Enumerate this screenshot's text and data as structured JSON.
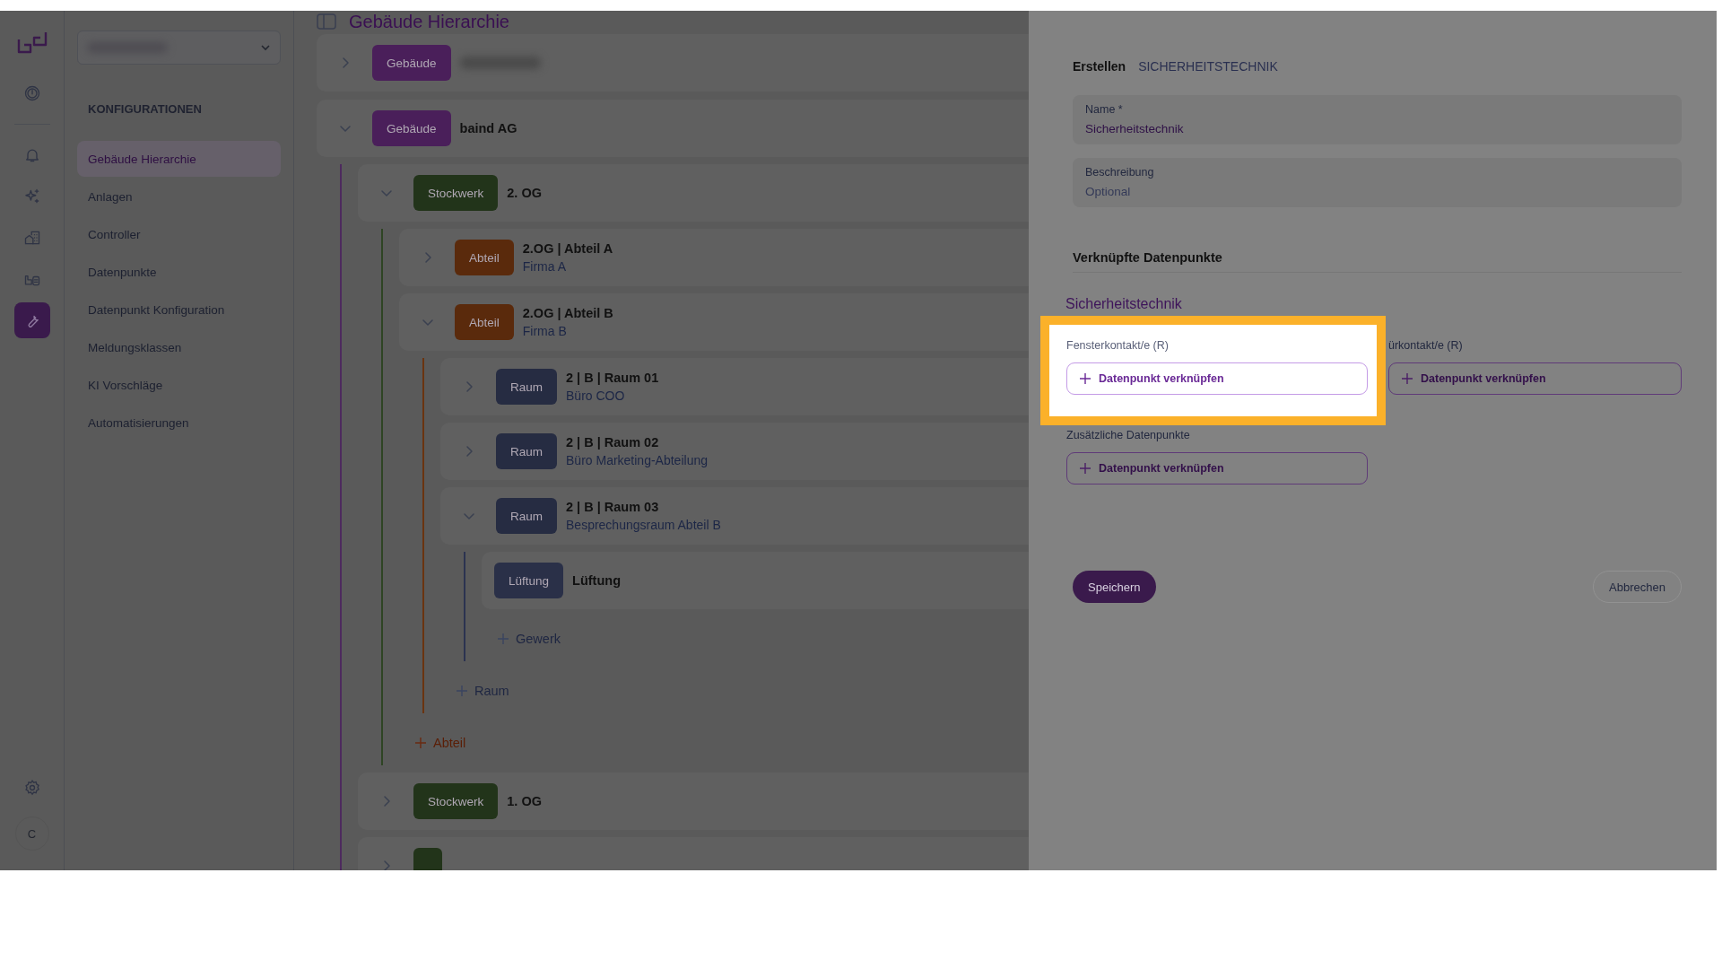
{
  "rail": {
    "items": [
      {
        "kind": "dashboard",
        "selected": false
      },
      {
        "kind": "bell",
        "selected": false
      },
      {
        "kind": "sparkles",
        "selected": false
      },
      {
        "kind": "buildings",
        "selected": false
      },
      {
        "kind": "plant",
        "selected": false
      },
      {
        "kind": "wrench",
        "selected": true
      }
    ],
    "avatar": "C"
  },
  "nav": {
    "heading": "KONFIGURATIONEN",
    "items": [
      {
        "label": "Gebäude Hierarchie",
        "selected": true
      },
      {
        "label": "Anlagen",
        "selected": false
      },
      {
        "label": "Controller",
        "selected": false
      },
      {
        "label": "Datenpunkte",
        "selected": false
      },
      {
        "label": "Datenpunkt Konfiguration",
        "selected": false
      },
      {
        "label": "Meldungsklassen",
        "selected": false
      },
      {
        "label": "KI Vorschläge",
        "selected": false
      },
      {
        "label": "Automatisierungen",
        "selected": false
      }
    ]
  },
  "main": {
    "title": "Gebäude Hierarchie",
    "tree": [
      {
        "kind": "building",
        "badge": "Gebäude",
        "redacted": true,
        "expanded": false
      },
      {
        "kind": "building",
        "badge": "Gebäude",
        "title": "baind AG",
        "expanded": true,
        "children": [
          {
            "kind": "floor",
            "badge": "Stockwerk",
            "title": "2. OG",
            "expanded": true,
            "add_label": "Abteil",
            "children": [
              {
                "kind": "section",
                "badge": "Abteil",
                "title": "2.OG | Abteil A",
                "subtitle": "Firma A",
                "expanded": false
              },
              {
                "kind": "section",
                "badge": "Abteil",
                "title": "2.OG | Abteil B",
                "subtitle": "Firma B",
                "expanded": true,
                "add_label": "Raum",
                "children": [
                  {
                    "kind": "room",
                    "badge": "Raum",
                    "title": "2 | B | Raum 01",
                    "subtitle": "Büro COO",
                    "expanded": false
                  },
                  {
                    "kind": "room",
                    "badge": "Raum",
                    "title": "2 | B | Raum 02",
                    "subtitle": "Büro Marketing-Abteilung",
                    "expanded": false
                  },
                  {
                    "kind": "room",
                    "badge": "Raum",
                    "title": "2 | B | Raum 03",
                    "subtitle": "Besprechungsraum Abteil B",
                    "expanded": true,
                    "add_label": "Gewerk",
                    "children": [
                      {
                        "kind": "trade",
                        "badge": "Lüftung",
                        "title": "Lüftung"
                      }
                    ]
                  }
                ]
              }
            ]
          },
          {
            "kind": "floor",
            "badge": "Stockwerk",
            "title": "1. OG",
            "expanded": false
          },
          {
            "kind": "floor",
            "expanded": false
          }
        ]
      }
    ]
  },
  "drawer": {
    "breadcrumb": [
      {
        "label": "Erstellen",
        "selected": true
      },
      {
        "label": "SICHERHEITSTECHNIK",
        "selected": false
      }
    ],
    "fields": [
      {
        "label": "Name *",
        "value": "Sicherheitstechnik"
      },
      {
        "label": "Beschreibung",
        "placeholder": "Optional"
      }
    ],
    "section_title": "Verknüpfte Datenpunkte",
    "group_title": "Sicherheitstechnik",
    "slots": [
      {
        "label": "Fensterkontakt/e (R)",
        "button": "Datenpunkt verknüpfen",
        "highlighted": true
      },
      {
        "label": "ürkontakt/e (R)",
        "button": "Datenpunkt verknüpfen",
        "highlighted": false
      },
      {
        "label": "Zusätzliche Datenpunkte",
        "button": "Datenpunkt verknüpfen",
        "highlighted": false
      }
    ],
    "buttons": [
      {
        "label": "Speichern",
        "kind": "primary"
      },
      {
        "label": "Abbrechen",
        "kind": "secondary"
      }
    ]
  }
}
